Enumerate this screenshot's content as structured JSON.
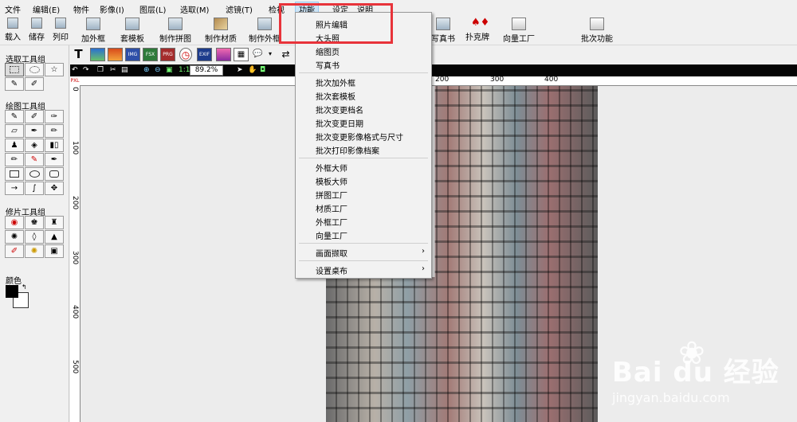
{
  "menubar": {
    "items": [
      "文件",
      "编辑(E)",
      "物件",
      "影像(I)",
      "图层(L)",
      "选取(M)",
      "滤镜(T)",
      "检视",
      "功能",
      "设定",
      "说明"
    ]
  },
  "toolbar": {
    "buttons": [
      "载入",
      "储存",
      "列印",
      "加外框",
      "套模板",
      "制作拼图",
      "制作材质",
      "制作外框",
      "写真书",
      "扑克牌",
      "向量工厂",
      "批次功能"
    ]
  },
  "left_panel": {
    "select_group": "选取工具组",
    "draw_group": "绘图工具组",
    "retouch_group": "修片工具组",
    "color_label": "颜色"
  },
  "toolbar2": {
    "text_tool": "T",
    "img": "IMG",
    "fsx": "FSX",
    "prg": "PRG",
    "exif": "EXIF",
    "more": "▾"
  },
  "view_bar": {
    "zoom": "89.2%",
    "fit": "1:1",
    "unit": "PXL"
  },
  "ruler": {
    "top": [
      "200",
      "300",
      "400"
    ],
    "left": [
      "0",
      "100",
      "200",
      "300",
      "400",
      "500"
    ]
  },
  "dropdown": {
    "items": [
      "照片编辑",
      "大头照",
      "缩图页",
      "写真书",
      "批次加外框",
      "批次套模板",
      "批次变更档名",
      "批次变更日期",
      "批次变更影像格式与尺寸",
      "批次打印影像档案",
      "外框大师",
      "模板大师",
      "拼图工厂",
      "材质工厂",
      "外框工厂",
      "向量工厂",
      "画面撷取",
      "设置桌布"
    ],
    "submenu_arrow": "›"
  },
  "watermark": {
    "brand": "Bai du 经验",
    "url": "jingyan.baidu.com"
  },
  "colors": {
    "highlight": "#e8333a",
    "menu_active": "#cce4f7"
  }
}
